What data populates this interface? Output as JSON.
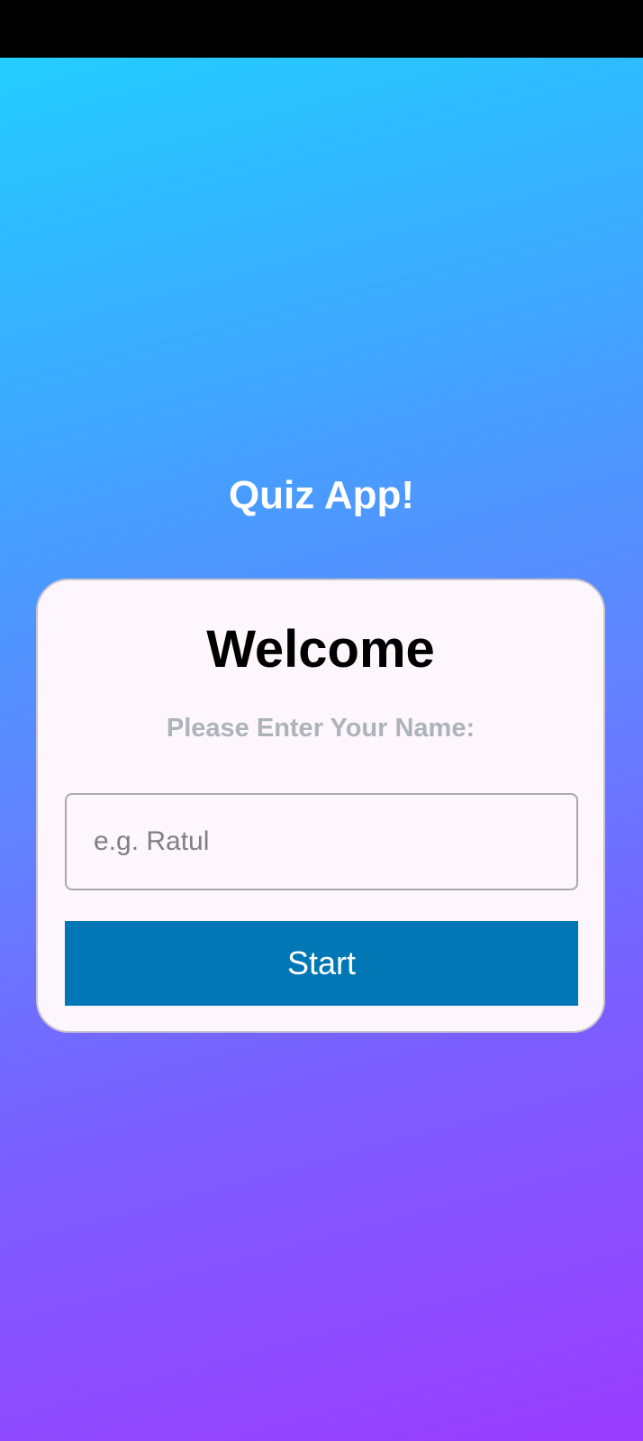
{
  "app": {
    "title": "Quiz App!"
  },
  "card": {
    "heading": "Welcome",
    "prompt": "Please Enter Your Name:",
    "name_input": {
      "value": "",
      "placeholder": "e.g. Ratul"
    },
    "start_label": "Start"
  },
  "colors": {
    "status_bar": "#000000",
    "gradient_top": "#1fd3ff",
    "gradient_bottom": "#9a3dff",
    "card_background": "#fdf6fc",
    "start_button": "#0177b5",
    "prompt_text": "#adb3ba"
  }
}
